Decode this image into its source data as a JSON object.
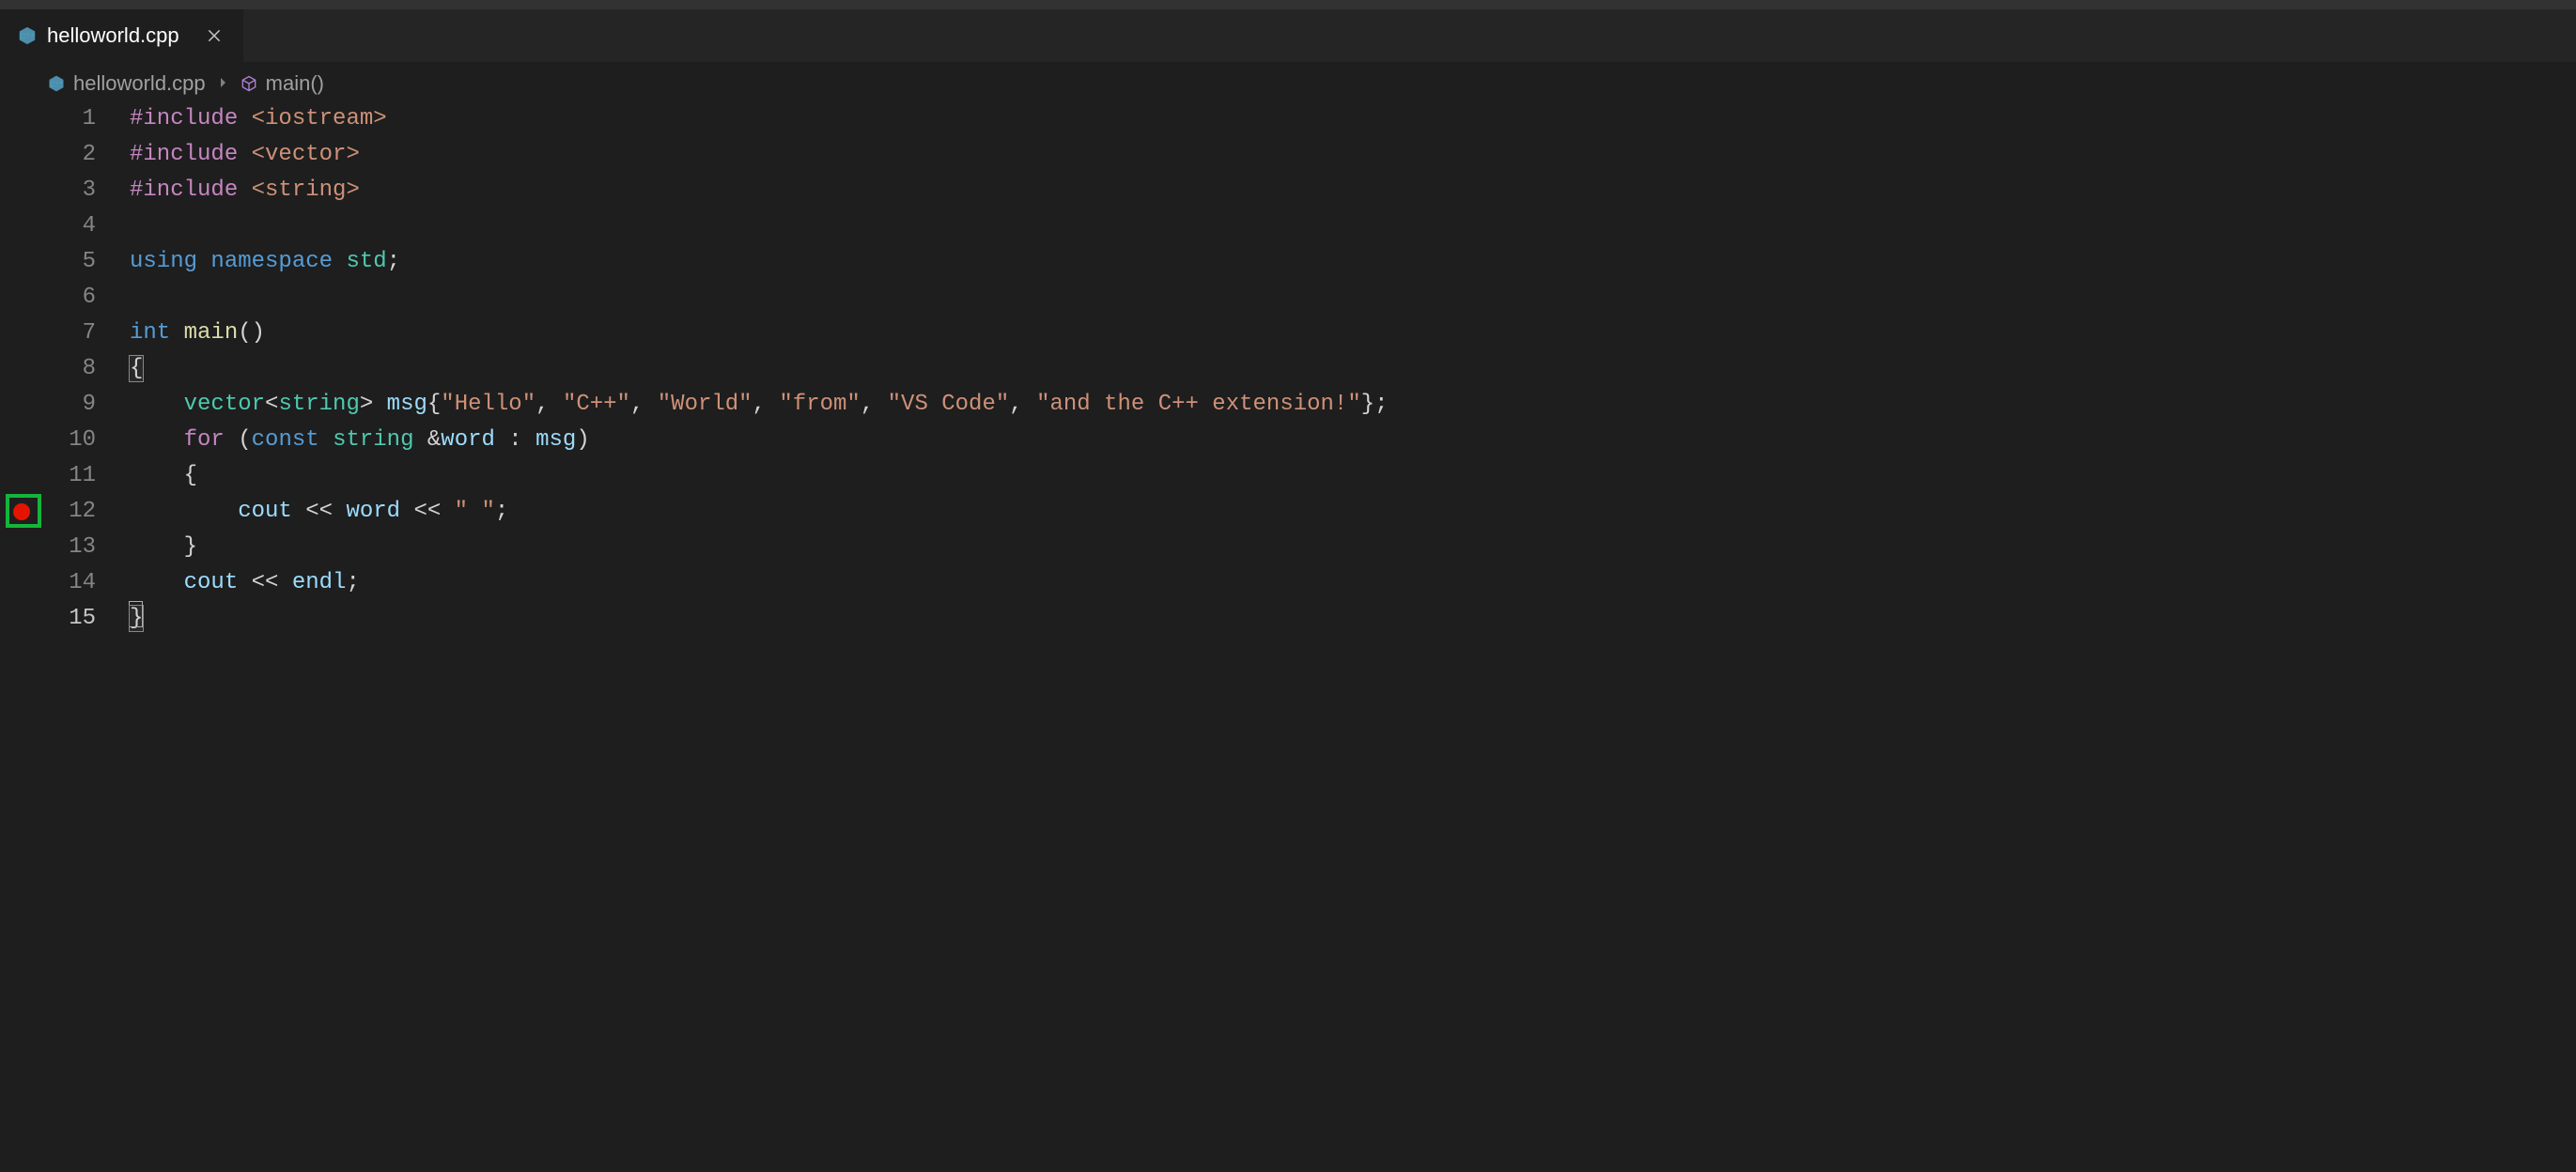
{
  "tab": {
    "filename": "helloworld.cpp"
  },
  "breadcrumb": {
    "file": "helloworld.cpp",
    "symbol": "main()"
  },
  "breakpoint": {
    "line": 12
  },
  "cursor_line": 15,
  "lines": [
    {
      "n": 1,
      "tokens": [
        [
          "pp",
          "#include"
        ],
        [
          "punc",
          " "
        ],
        [
          "hdr",
          "<iostream>"
        ]
      ]
    },
    {
      "n": 2,
      "tokens": [
        [
          "pp",
          "#include"
        ],
        [
          "punc",
          " "
        ],
        [
          "hdr",
          "<vector>"
        ]
      ]
    },
    {
      "n": 3,
      "tokens": [
        [
          "pp",
          "#include"
        ],
        [
          "punc",
          " "
        ],
        [
          "hdr",
          "<string>"
        ]
      ]
    },
    {
      "n": 4,
      "tokens": []
    },
    {
      "n": 5,
      "tokens": [
        [
          "kw",
          "using"
        ],
        [
          "punc",
          " "
        ],
        [
          "kw",
          "namespace"
        ],
        [
          "punc",
          " "
        ],
        [
          "type",
          "std"
        ],
        [
          "punc",
          ";"
        ]
      ]
    },
    {
      "n": 6,
      "tokens": []
    },
    {
      "n": 7,
      "tokens": [
        [
          "kw",
          "int"
        ],
        [
          "punc",
          " "
        ],
        [
          "func",
          "main"
        ],
        [
          "punc",
          "()"
        ]
      ]
    },
    {
      "n": 8,
      "tokens": [
        [
          "punc",
          "{"
        ]
      ],
      "match_open": true
    },
    {
      "n": 9,
      "tokens": [
        [
          "punc",
          "    "
        ],
        [
          "type",
          "vector"
        ],
        [
          "punc",
          "<"
        ],
        [
          "type",
          "string"
        ],
        [
          "punc",
          "> "
        ],
        [
          "var",
          "msg"
        ],
        [
          "punc",
          "{"
        ],
        [
          "str",
          "\"Hello\""
        ],
        [
          "punc",
          ", "
        ],
        [
          "str",
          "\"C++\""
        ],
        [
          "punc",
          ", "
        ],
        [
          "str",
          "\"World\""
        ],
        [
          "punc",
          ", "
        ],
        [
          "str",
          "\"from\""
        ],
        [
          "punc",
          ", "
        ],
        [
          "str",
          "\"VS Code\""
        ],
        [
          "punc",
          ", "
        ],
        [
          "str",
          "\"and the C++ extension!\""
        ],
        [
          "punc",
          "};"
        ]
      ]
    },
    {
      "n": 10,
      "tokens": [
        [
          "punc",
          "    "
        ],
        [
          "pp",
          "for"
        ],
        [
          "punc",
          " ("
        ],
        [
          "kw",
          "const"
        ],
        [
          "punc",
          " "
        ],
        [
          "type",
          "string"
        ],
        [
          "punc",
          " &"
        ],
        [
          "var",
          "word"
        ],
        [
          "punc",
          " : "
        ],
        [
          "var",
          "msg"
        ],
        [
          "punc",
          ")"
        ]
      ]
    },
    {
      "n": 11,
      "tokens": [
        [
          "punc",
          "    {"
        ]
      ]
    },
    {
      "n": 12,
      "tokens": [
        [
          "punc",
          "        "
        ],
        [
          "var",
          "cout"
        ],
        [
          "punc",
          " << "
        ],
        [
          "var",
          "word"
        ],
        [
          "punc",
          " << "
        ],
        [
          "str",
          "\" \""
        ],
        [
          "punc",
          ";"
        ]
      ]
    },
    {
      "n": 13,
      "tokens": [
        [
          "punc",
          "    }"
        ]
      ]
    },
    {
      "n": 14,
      "tokens": [
        [
          "punc",
          "    "
        ],
        [
          "var",
          "cout"
        ],
        [
          "punc",
          " << "
        ],
        [
          "var",
          "endl"
        ],
        [
          "punc",
          ";"
        ]
      ]
    },
    {
      "n": 15,
      "tokens": [
        [
          "punc",
          "}"
        ]
      ],
      "match_close": true
    }
  ]
}
